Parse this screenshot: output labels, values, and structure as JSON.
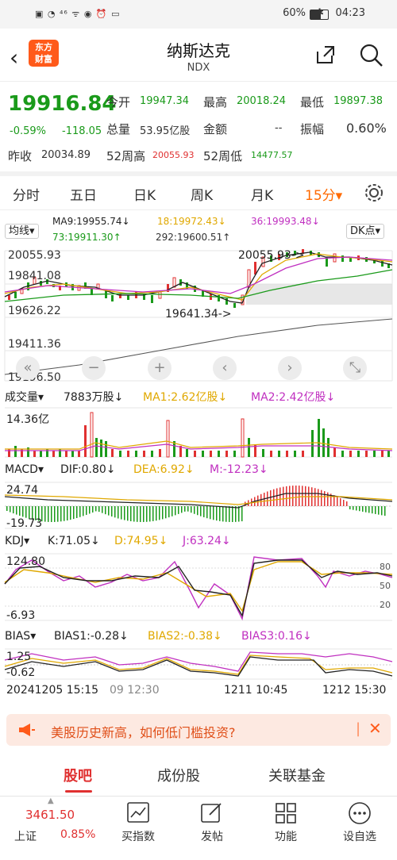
{
  "status_bar": {
    "left_icons": "▣ ◔ ⁴⁶ ᯤ ◉ ⏰ ▭",
    "battery": "60%",
    "time": "04:23"
  },
  "header": {
    "title": "纳斯达克",
    "subtitle": "NDX",
    "logo_line1": "东方",
    "logo_line2": "财富"
  },
  "quote": {
    "price": "19916.84",
    "change_pct": "-0.59%",
    "change": "-118.05",
    "open_label": "今开",
    "open": "19947.34",
    "high_label": "最高",
    "high": "20018.24",
    "low_label": "最低",
    "low": "19897.38",
    "volume_label": "总量",
    "volume": "53.95亿股",
    "amount_label": "金额",
    "amount": "--",
    "amp_label": "振幅",
    "amp": "0.60%",
    "prev_label": "昨收",
    "prev": "20034.89",
    "w52h_label": "52周高",
    "w52h": "20055.93",
    "w52l_label": "52周低",
    "w52l": "14477.57"
  },
  "period_tabs": [
    "分时",
    "五日",
    "日K",
    "周K",
    "月K",
    "15分▾"
  ],
  "ma_panel": {
    "selector": "均线▾",
    "ma9": "MA9:19955.74↓",
    "ma18": "18:19972.43↓",
    "ma36": "36:19993.48↓",
    "ma73": "73:19911.30↑",
    "ma292": "292:19600.51↑",
    "dk": "DK点▾"
  },
  "price_axis": [
    "20055.93",
    "19841.08",
    "19626.22",
    "19411.36",
    "19196.50"
  ],
  "annotations": {
    "high": "20055.93->",
    "low": "19641.34->"
  },
  "nav_buttons": [
    "«",
    "−",
    "+",
    "‹",
    "›",
    "⤡"
  ],
  "volume_panel": {
    "label": "成交量▾",
    "vol": "7883万股↓",
    "ma1": "MA1:2.62亿股↓",
    "ma2": "MA2:2.42亿股↓",
    "max": "14.36亿"
  },
  "macd_panel": {
    "label": "MACD▾",
    "dif": "DIF:0.80↓",
    "dea": "DEA:6.92↓",
    "m": "M:-12.23↓",
    "top": "24.74",
    "bottom": "-19.73"
  },
  "kdj_panel": {
    "label": "KDJ▾",
    "k": "K:71.05↓",
    "d": "D:74.95↓",
    "j": "J:63.24↓",
    "top": "124.80",
    "bottom": "-6.93",
    "r80": "80",
    "r50": "50",
    "r20": "20"
  },
  "bias_panel": {
    "label": "BIAS▾",
    "b1": "BIAS1:-0.28↓",
    "b2": "BIAS2:-0.38↓",
    "b3": "BIAS3:0.16↓",
    "top": "1.25",
    "bottom": "-0.62"
  },
  "time_axis": {
    "t1": "20241205 15:15",
    "t1b": "09 12:30",
    "t2": "1211 10:45",
    "t3": "1212 15:30"
  },
  "banner": {
    "text": "美股历史新高，如何低门槛投资?"
  },
  "bottom_tabs": [
    "股吧",
    "成份股",
    "关联基金"
  ],
  "footer": {
    "index_price": "3461.50",
    "index_name": "上证",
    "index_pct": "0.85%",
    "items": [
      "买指数",
      "发帖",
      "功能",
      "设自选"
    ]
  },
  "colors": {
    "up": "#e03030",
    "down": "#1a9a1a",
    "accent": "#ff6a00"
  }
}
